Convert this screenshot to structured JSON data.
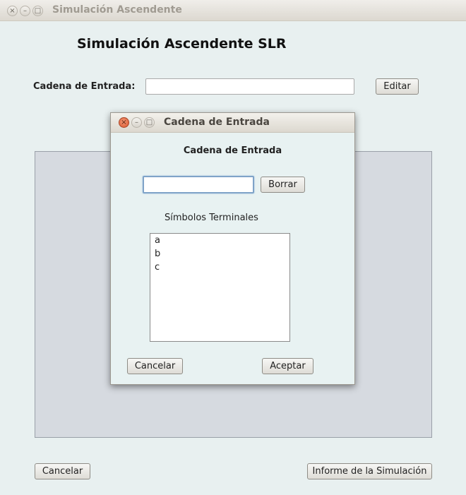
{
  "main_window": {
    "title": "Simulación Ascendente",
    "controls": {
      "close": "×",
      "minimize": "–",
      "maximize": "□"
    },
    "heading": "Simulación Ascendente SLR",
    "input_label": "Cadena de Entrada:",
    "input_value": "",
    "edit_button": "Editar",
    "cancel_button": "Cancelar",
    "report_button": "Informe de la Simulación"
  },
  "dialog": {
    "title": "Cadena de Entrada",
    "controls": {
      "close": "×",
      "minimize": "–",
      "maximize": "□"
    },
    "heading": "Cadena de Entrada",
    "input_value": "",
    "clear_button": "Borrar",
    "terminals_label": "Símbolos Terminales",
    "terminals": [
      "a",
      "b",
      "c"
    ],
    "cancel_button": "Cancelar",
    "accept_button": "Aceptar"
  }
}
